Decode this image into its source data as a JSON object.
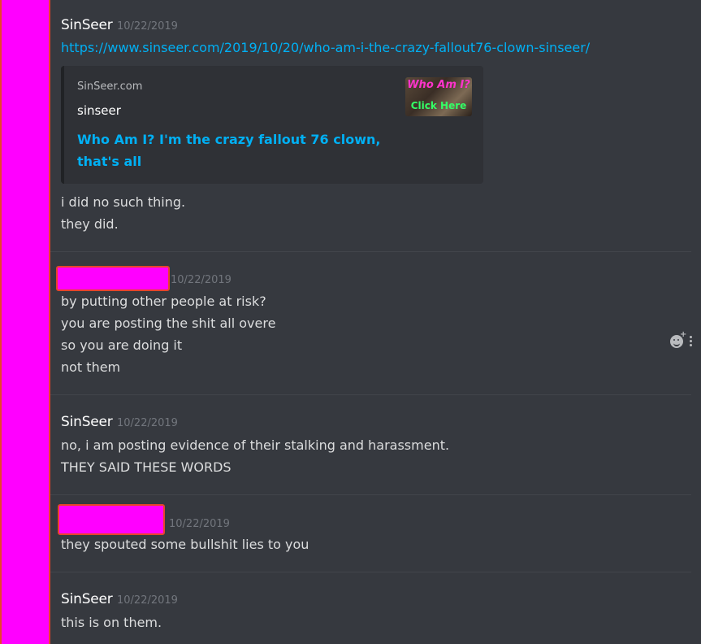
{
  "messages": [
    {
      "author": "SinSeer",
      "timestamp": "10/22/2019",
      "link": "https://www.sinseer.com/2019/10/20/who-am-i-the-crazy-fallout76-clown-sinseer/",
      "embed": {
        "provider": "SinSeer.com",
        "author": "sinseer",
        "title": "Who Am I? I'm the crazy fallout 76 clown, that's all",
        "thumbnail_top": "Who Am I?",
        "thumbnail_bottom": "Click Here"
      },
      "lines": [
        "i did no such thing.",
        "they did."
      ]
    },
    {
      "author": "",
      "timestamp": "10/22/2019",
      "lines": [
        "by putting other people at risk?",
        "you are posting the shit all overe",
        "so you are doing it",
        "not them"
      ]
    },
    {
      "author": "SinSeer",
      "timestamp": "10/22/2019",
      "lines": [
        "no, i am posting evidence of their stalking and harassment.",
        "THEY SAID THESE WORDS"
      ]
    },
    {
      "author": "",
      "timestamp": "10/22/2019",
      "lines": [
        "they spouted some bullshit lies to  you"
      ]
    },
    {
      "author": "SinSeer",
      "timestamp": "10/22/2019",
      "lines": [
        "this is on them."
      ]
    }
  ],
  "icons": {
    "add_reaction": "emoji-plus-icon",
    "more": "more-options-icon"
  },
  "colors": {
    "background": "#36393f",
    "link": "#00b0f4",
    "redaction": "#ff00ff"
  }
}
